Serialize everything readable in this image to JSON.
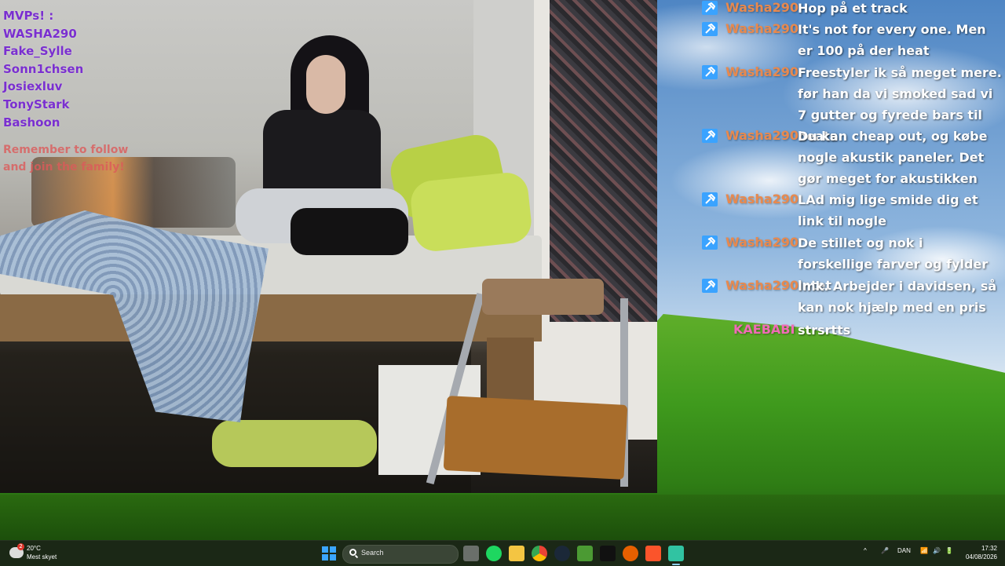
{
  "overlay": {
    "mvp_title": "MVPs! :",
    "mvps": [
      "WASHA290",
      "Fake_Sylle",
      "Sonn1chsen",
      "Josiexluv",
      "TonyStark",
      "Bashoon"
    ],
    "reminder": "Remember to follow and join the family!"
  },
  "chat": {
    "messages": [
      {
        "user": "Washa290",
        "text": "Hop på et track"
      },
      {
        "user": "Washa290",
        "text": "It's not for every one. Men er 100 på der heat"
      },
      {
        "user": "Washa290",
        "text": "Freestyler ik så meget mere. før han da vi smoked sad vi 7 gutter og fyrede bars til beats"
      },
      {
        "user": "Washa290",
        "text": "Du kan cheap out, og købe nogle akustik paneler. Det gør meget for akustikken"
      },
      {
        "user": "Washa290",
        "text": "LAd mig lige smide dig et link til nogle"
      },
      {
        "user": "Washa290",
        "text": "De stillet og nok i forskellige farver og fylder intet"
      },
      {
        "user": "Washa290",
        "text": "Imk. Arbejder i davidsen, så kan nok hjælp med en pris"
      },
      {
        "user": "KAEBABI",
        "text": "strsrtts"
      }
    ],
    "colors": {
      "user": "#e8894e",
      "user_alt": "#f06bb6",
      "badge": "#3aa3ff"
    }
  },
  "taskbar": {
    "weather": {
      "badge": "2",
      "temperature": "20°C",
      "condition": "Mest skyet"
    },
    "search_placeholder": "Search",
    "apps": [
      "task-view-icon",
      "spotify-icon",
      "file-explorer-icon",
      "chrome-icon",
      "steam-icon",
      "minecraft-icon",
      "capcut-icon",
      "firefox-icon",
      "brave-icon",
      "streamlabs-icon"
    ],
    "language": "DAN",
    "time": "17:32",
    "date": "04/08/2026"
  }
}
